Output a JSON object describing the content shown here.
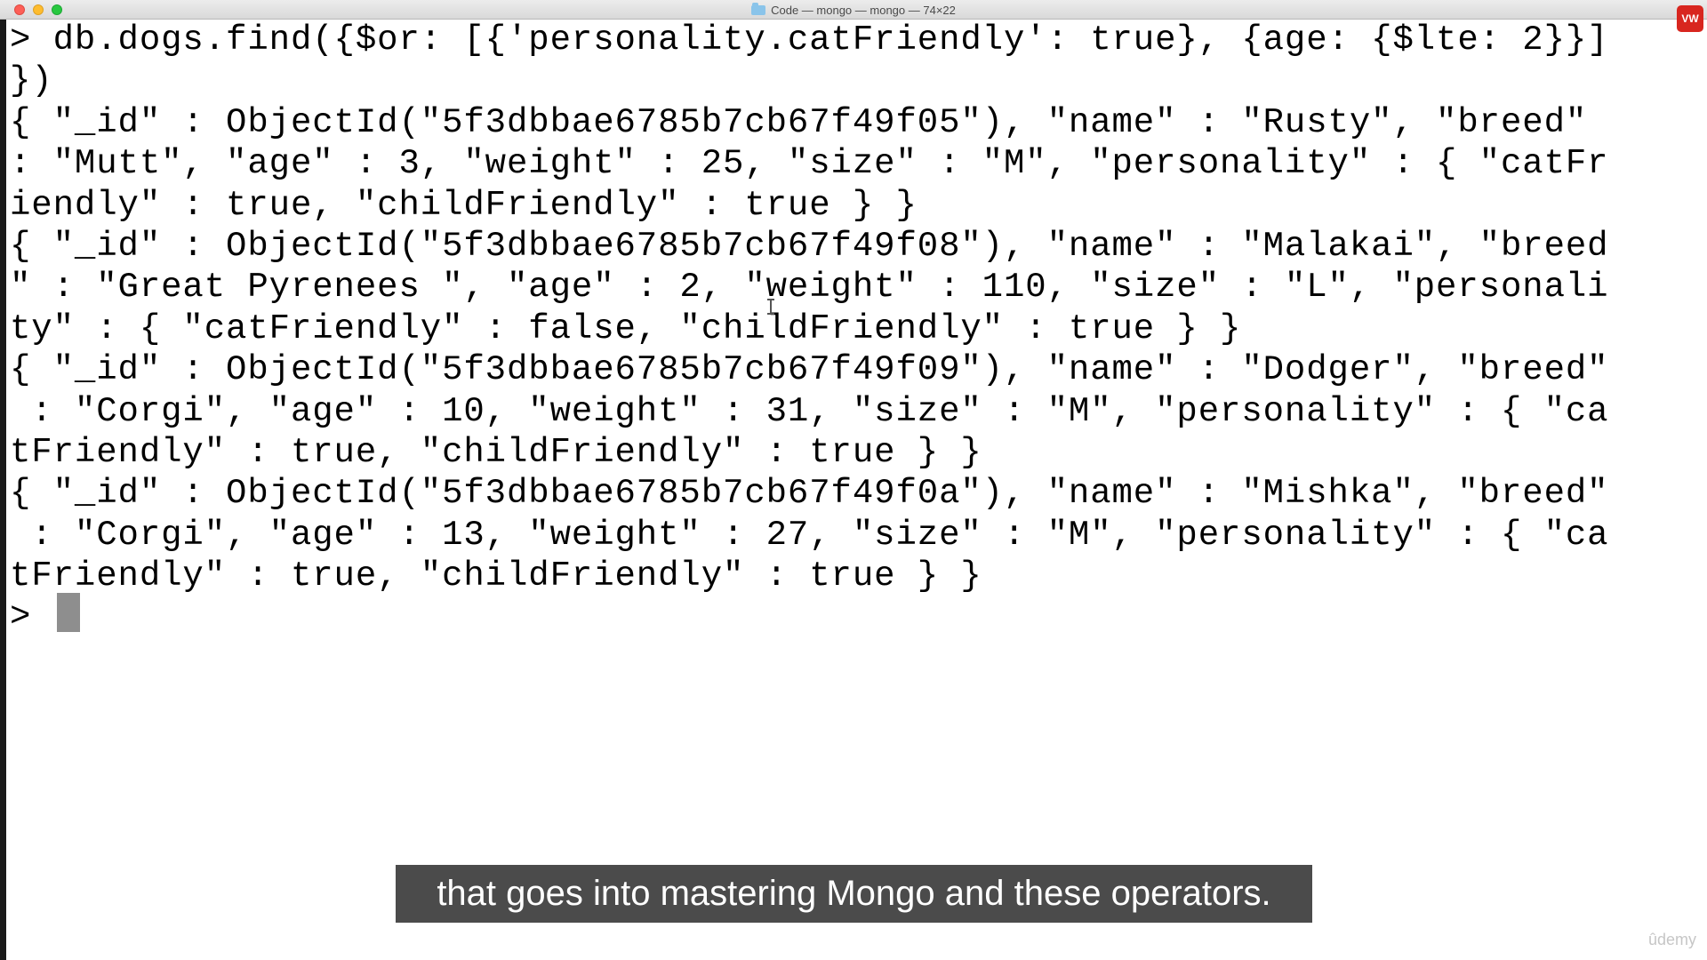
{
  "window": {
    "title": "Code — mongo — mongo — 74×22",
    "badge": "VW"
  },
  "terminal": {
    "lines": [
      "> db.dogs.find({$or: [{'personality.catFriendly': true}, {age: {$lte: 2}}]",
      "})",
      "{ \"_id\" : ObjectId(\"5f3dbbae6785b7cb67f49f05\"), \"name\" : \"Rusty\", \"breed\"",
      ": \"Mutt\", \"age\" : 3, \"weight\" : 25, \"size\" : \"M\", \"personality\" : { \"catFr",
      "iendly\" : true, \"childFriendly\" : true } }",
      "{ \"_id\" : ObjectId(\"5f3dbbae6785b7cb67f49f08\"), \"name\" : \"Malakai\", \"breed",
      "\" : \"Great Pyrenees \", \"age\" : 2, \"weight\" : 110, \"size\" : \"L\", \"personali",
      "ty\" : { \"catFriendly\" : false, \"childFriendly\" : true } }",
      "{ \"_id\" : ObjectId(\"5f3dbbae6785b7cb67f49f09\"), \"name\" : \"Dodger\", \"breed\"",
      " : \"Corgi\", \"age\" : 10, \"weight\" : 31, \"size\" : \"M\", \"personality\" : { \"ca",
      "tFriendly\" : true, \"childFriendly\" : true } }",
      "{ \"_id\" : ObjectId(\"5f3dbbae6785b7cb67f49f0a\"), \"name\" : \"Mishka\", \"breed\"",
      " : \"Corgi\", \"age\" : 13, \"weight\" : 27, \"size\" : \"M\", \"personality\" : { \"ca",
      "tFriendly\" : true, \"childFriendly\" : true } }",
      ">"
    ]
  },
  "caption": "that goes into mastering Mongo and these operators.",
  "watermark": "ûdemy"
}
